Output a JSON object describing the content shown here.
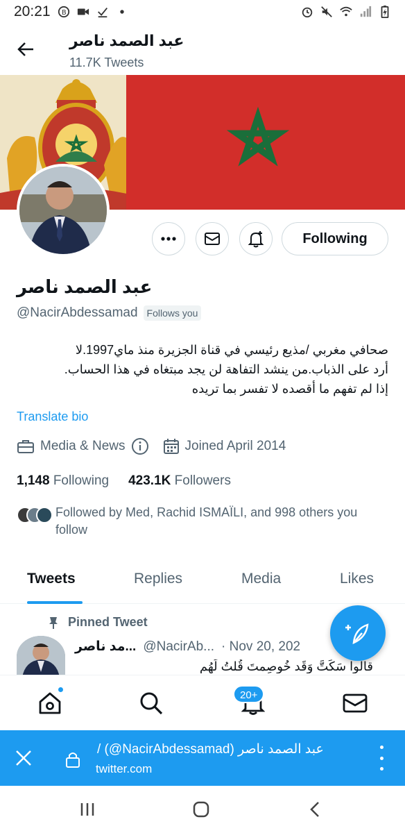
{
  "status_bar": {
    "time": "20:21"
  },
  "header": {
    "name": "عبد الصمد ناصر",
    "tweet_count": "11.7K Tweets"
  },
  "profile": {
    "following_button": "Following",
    "name": "عبد الصمد ناصر",
    "handle": "@NacirAbdessamad",
    "follows_you": "Follows you",
    "bio_lines": [
      "صحافي مغربي /مذيع رئيسي في قناة الجزيرة منذ ماي1997.لا",
      "أرد على الذباب.من ينشد التفاهة لن يجد مبتغاه في هذا الحساب.",
      "إذا لم تفهم ما أقصده لا تفسر بما تريده"
    ],
    "translate_bio": "Translate bio",
    "category": "Media & News",
    "joined": "Joined April 2014",
    "following_count": "1,148",
    "following_label": "Following",
    "followers_count": "423.1K",
    "followers_label": "Followers",
    "followed_by": "Followed by Med, Rachid ISMAÏLI, and 998 others you follow"
  },
  "tabs": [
    "Tweets",
    "Replies",
    "Media",
    "Likes"
  ],
  "pinned_tweet": {
    "pinned_label": "Pinned Tweet",
    "name": "...مد ناصر",
    "handle": "@NacirAb...",
    "date": "· Nov 20, 202",
    "text": "قالوا سَكَتَّ وَقَد خُوصِمتَ قُلتُ لَهُم"
  },
  "bottom_nav": {
    "notifications_badge": "20+"
  },
  "browser_bar": {
    "title": "عبد الصمد ناصر (NacirAbdessamad@) /",
    "url": "twitter.com"
  },
  "colors": {
    "accent": "#1d9bf0",
    "flag_red": "#d22e2a",
    "flag_green": "#1a6e3a"
  }
}
